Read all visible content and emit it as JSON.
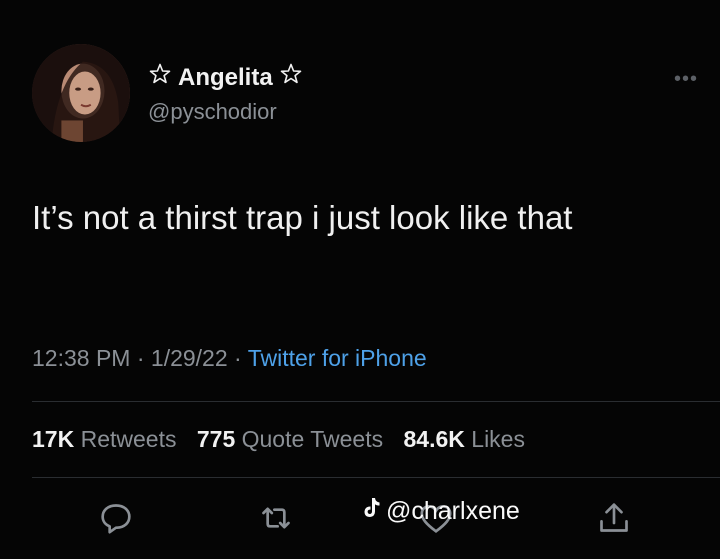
{
  "user": {
    "display_name": "Angelita",
    "handle": "@pyschodior",
    "name_prefix_icon": "star-outline-icon",
    "name_suffix_icon": "star-outline-icon"
  },
  "tweet": {
    "text": "It’s not a thirst trap i just look like that",
    "time": "12:38 PM",
    "date": "1/29/22",
    "separator": "·",
    "source": "Twitter for iPhone"
  },
  "stats": {
    "retweets_count": "17K",
    "retweets_label": "Retweets",
    "quotes_count": "775",
    "quotes_label": "Quote Tweets",
    "likes_count": "84.6K",
    "likes_label": "Likes"
  },
  "actions": [
    "reply-icon",
    "retweet-icon",
    "like-icon",
    "share-icon"
  ],
  "watermark": {
    "icon": "tiktok-icon",
    "text": "@charlxene"
  },
  "colors": {
    "background": "#050505",
    "text": "#e7e9ea",
    "muted": "#8b9096",
    "link": "#4ea1e8"
  }
}
